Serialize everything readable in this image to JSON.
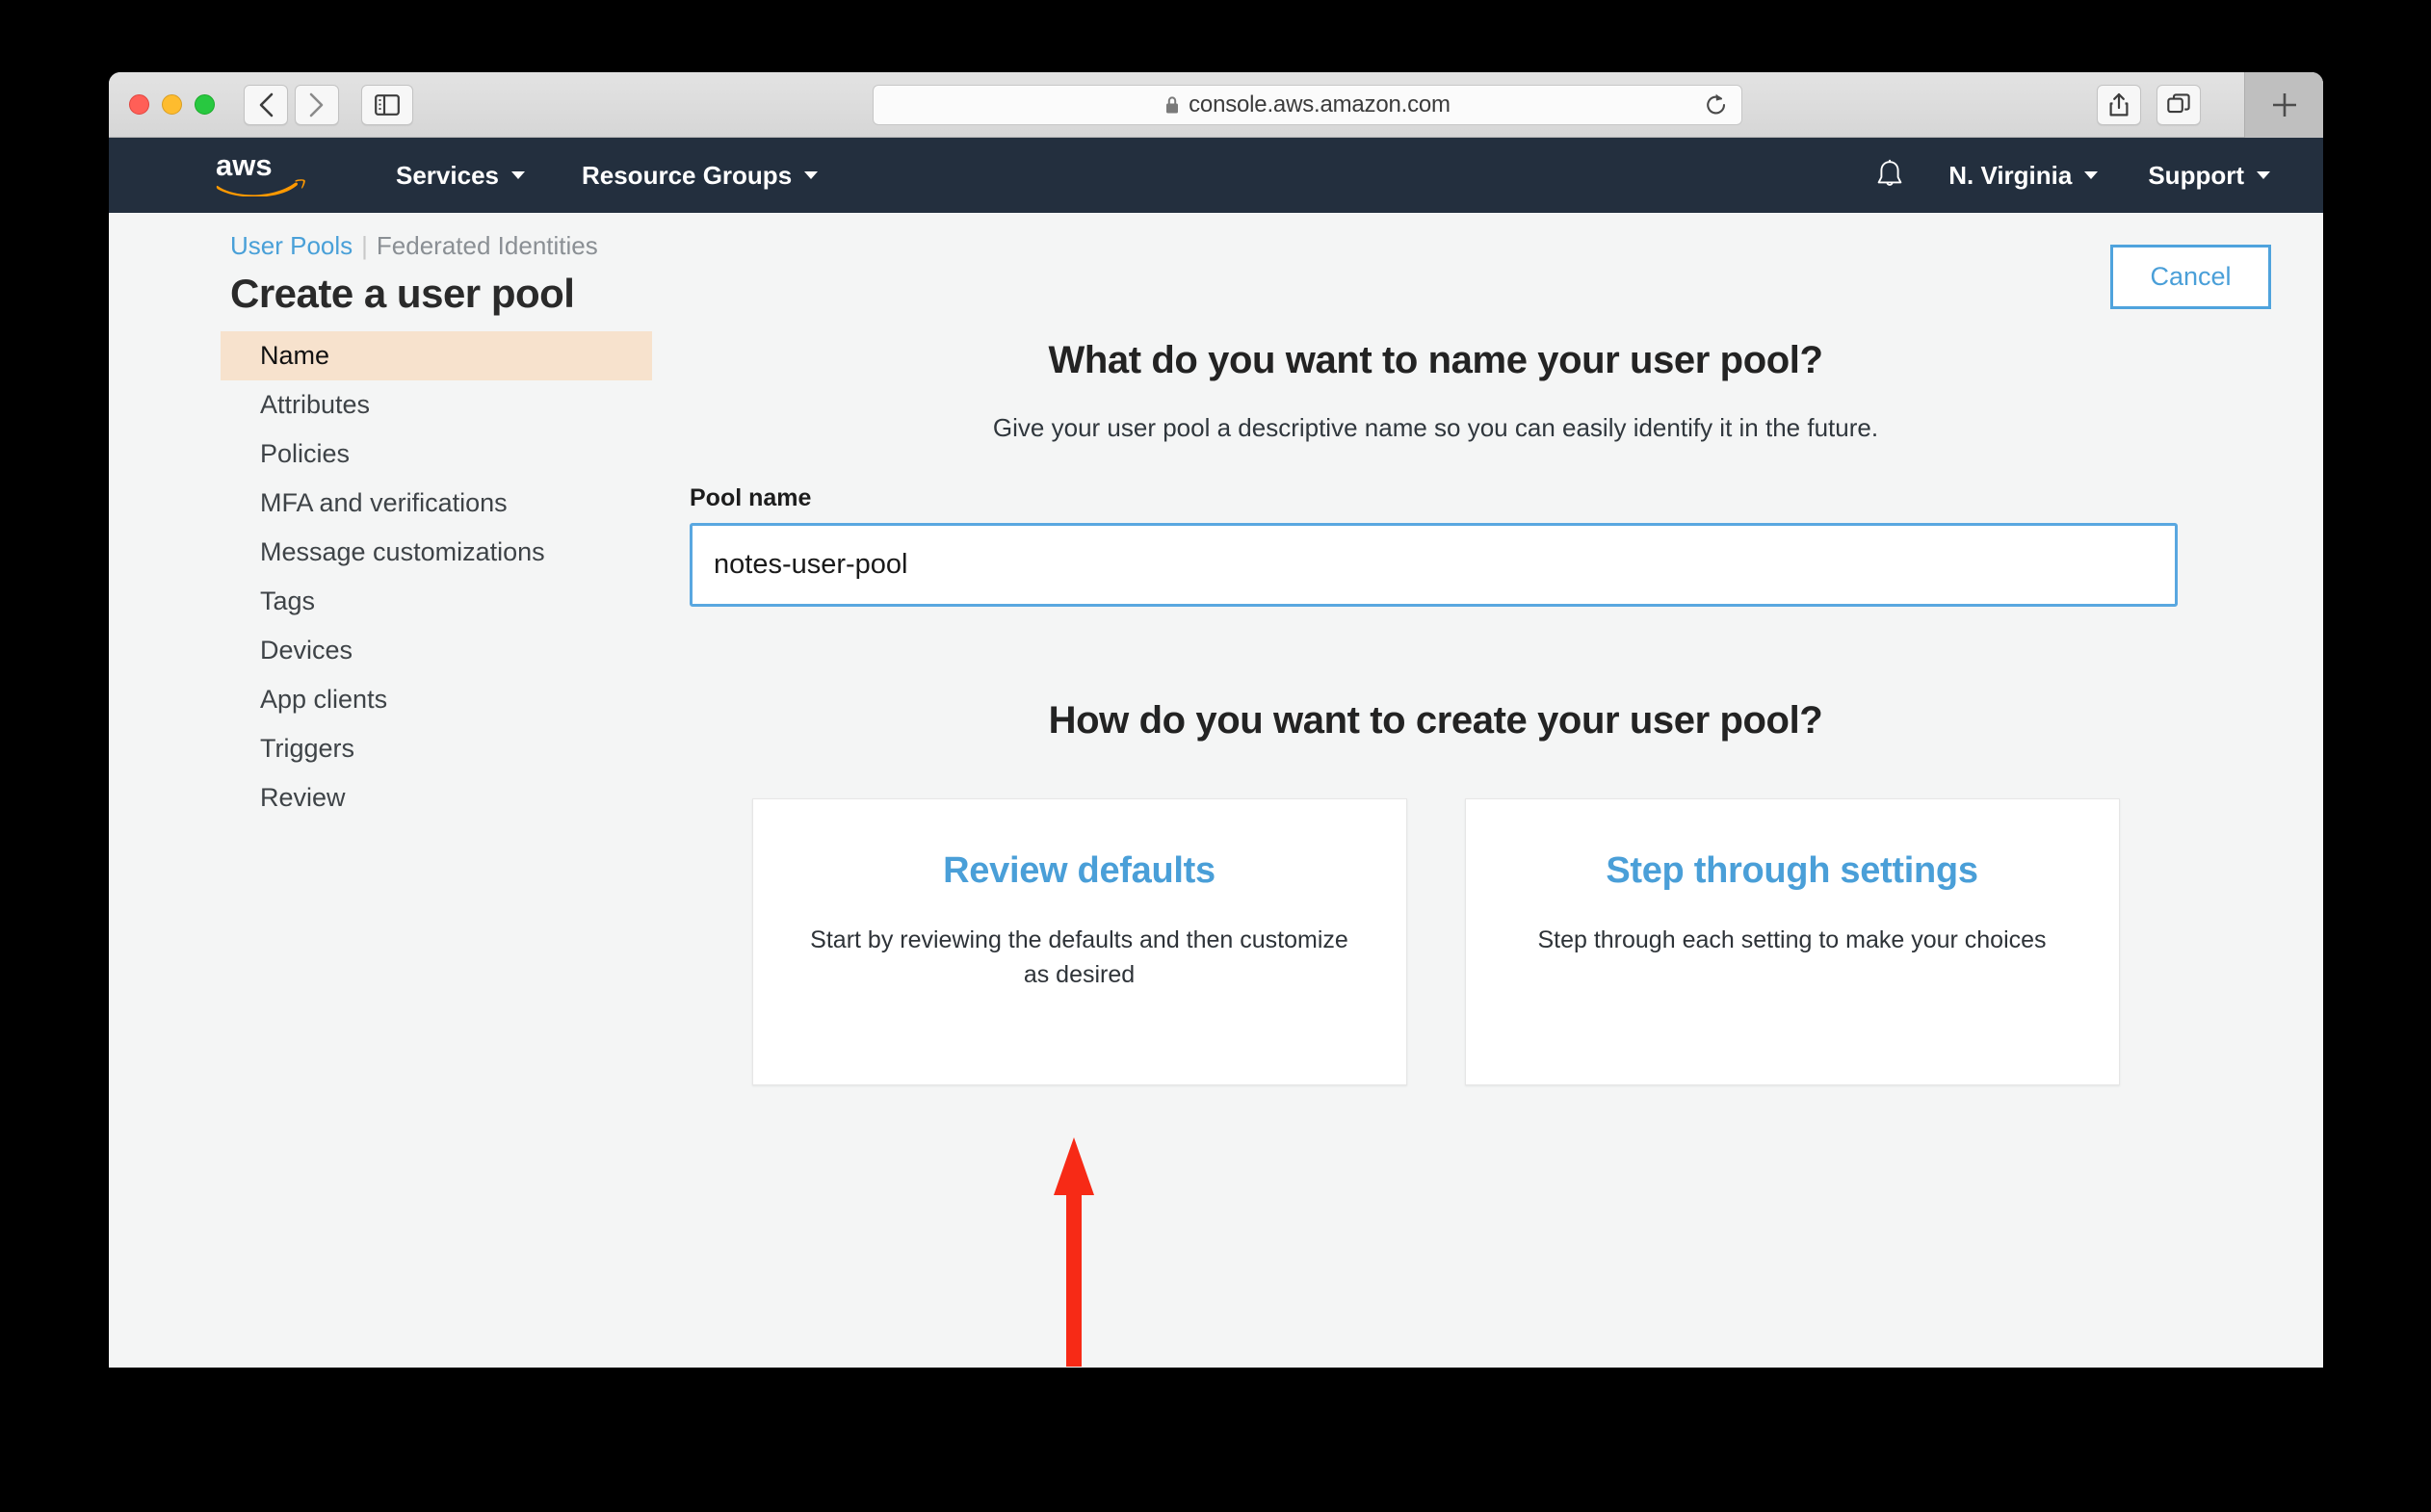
{
  "browser": {
    "url": "console.aws.amazon.com",
    "lock_icon": "lock-icon",
    "back_icon": "chevron-left-icon",
    "forward_icon": "chevron-right-icon",
    "sidebar_icon": "sidebar-toggle-icon",
    "reload_icon": "reload-icon",
    "share_icon": "share-icon",
    "tabs_icon": "tab-overview-icon",
    "new_tab_label": "+"
  },
  "aws_nav": {
    "logo": "aws-logo",
    "services_label": "Services",
    "resource_groups_label": "Resource Groups",
    "bell_icon": "notifications-bell-icon",
    "region_label": "N. Virginia",
    "support_label": "Support"
  },
  "breadcrumb": {
    "active": "User Pools",
    "separator": "|",
    "muted": "Federated Identities"
  },
  "header": {
    "title": "Create a user pool",
    "cancel_label": "Cancel"
  },
  "sidebar": {
    "items": [
      {
        "label": "Name",
        "active": true
      },
      {
        "label": "Attributes",
        "active": false
      },
      {
        "label": "Policies",
        "active": false
      },
      {
        "label": "MFA and verifications",
        "active": false
      },
      {
        "label": "Message customizations",
        "active": false
      },
      {
        "label": "Tags",
        "active": false
      },
      {
        "label": "Devices",
        "active": false
      },
      {
        "label": "App clients",
        "active": false
      },
      {
        "label": "Triggers",
        "active": false
      },
      {
        "label": "Review",
        "active": false
      }
    ]
  },
  "main": {
    "name_heading": "What do you want to name your user pool?",
    "name_subtitle": "Give your user pool a descriptive name so you can easily identify it in the future.",
    "pool_name_label": "Pool name",
    "pool_name_value": "notes-user-pool",
    "pool_name_placeholder": "",
    "create_heading": "How do you want to create your user pool?",
    "cards": [
      {
        "title": "Review defaults",
        "body": "Start by reviewing the defaults and then customize as desired"
      },
      {
        "title": "Step through settings",
        "body": "Step through each setting to make your choices"
      }
    ]
  },
  "annotation": {
    "arrow_color": "#f72a16",
    "points_to": "Review defaults"
  },
  "colors": {
    "aws_nav_bg": "#232f3e",
    "aws_orange": "#ff9900",
    "link_blue": "#4a9fd8",
    "sidebar_active_bg": "#f7e2cd",
    "page_bg": "#f4f5f5"
  }
}
